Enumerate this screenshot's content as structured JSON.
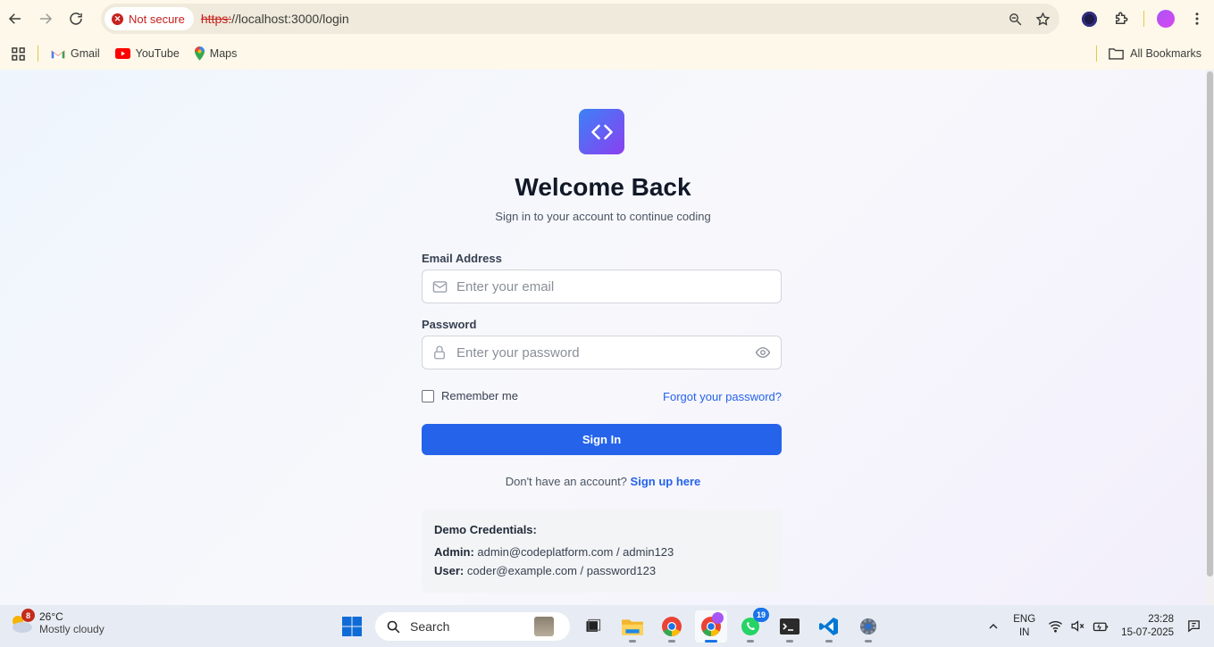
{
  "browser": {
    "security_label": "Not secure",
    "url_scheme": "https:",
    "url_rest": "//localhost:3000/login",
    "bookmarks": [
      {
        "label": "Gmail",
        "icon": "gmail-icon"
      },
      {
        "label": "YouTube",
        "icon": "youtube-icon"
      },
      {
        "label": "Maps",
        "icon": "maps-icon"
      }
    ],
    "all_bookmarks": "All Bookmarks"
  },
  "login": {
    "title": "Welcome Back",
    "subtitle": "Sign in to your account to continue coding",
    "email_label": "Email Address",
    "email_placeholder": "Enter your email",
    "password_label": "Password",
    "password_placeholder": "Enter your password",
    "remember": "Remember me",
    "forgot": "Forgot your password?",
    "signin": "Sign In",
    "signup_prompt": "Don't have an account?",
    "signup_link": "Sign up here",
    "demo": {
      "heading": "Demo Credentials:",
      "admin_label": "Admin:",
      "admin_value": "admin@codeplatform.com / admin123",
      "user_label": "User:",
      "user_value": "coder@example.com / password123"
    }
  },
  "taskbar": {
    "weather_badge": "8",
    "temperature": "26°C",
    "condition": "Mostly cloudy",
    "search": "Search",
    "whatsapp_badge": "19",
    "lang_top": "ENG",
    "lang_bottom": "IN",
    "time": "23:28",
    "date": "15-07-2025"
  },
  "colors": {
    "primary": "#2563eb",
    "logo_start": "#3b82f6",
    "logo_end": "#8b3ff0",
    "insecure": "#c5221f"
  }
}
